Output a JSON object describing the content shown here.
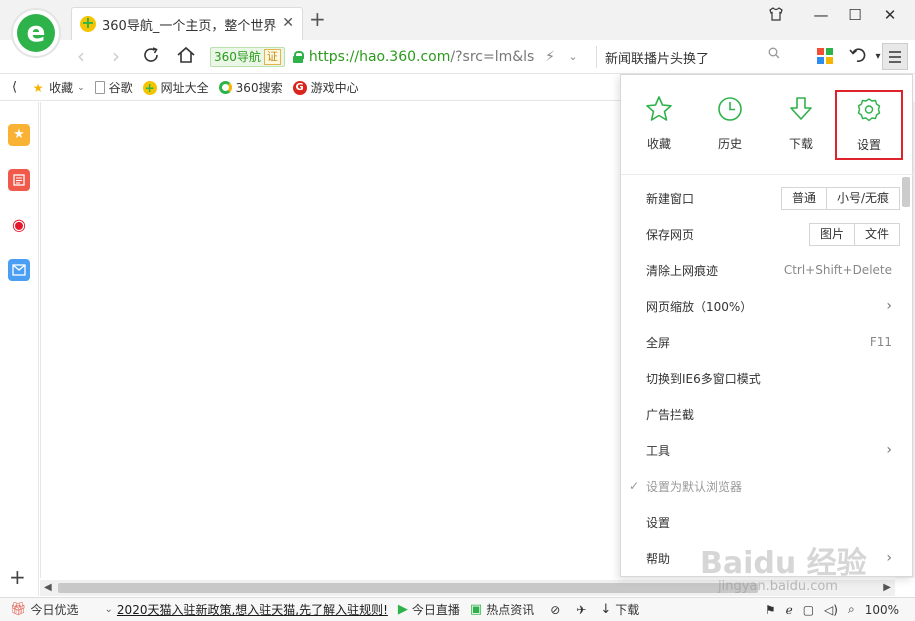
{
  "tab": {
    "title": "360导航_一个主页，整个世界",
    "close": "✕"
  },
  "newtab": "+",
  "window_controls": {
    "skin": "skin-icon",
    "minimize": "—",
    "maximize": "☐",
    "close": "✕"
  },
  "address": {
    "cert_label": "360导航",
    "cert_badge": "证",
    "url_main": "https://hao.360.com",
    "url_rest": "/?src=lm&ls"
  },
  "search": {
    "value": "新闻联播片头换了"
  },
  "bookmarks": {
    "toggle": "⟨",
    "items": [
      {
        "label": "收藏",
        "icon": "star-icon"
      },
      {
        "label": "谷歌",
        "icon": "page-icon"
      },
      {
        "label": "网址大全",
        "icon": "360-nav-icon"
      },
      {
        "label": "360搜索",
        "icon": "360-search-icon"
      },
      {
        "label": "游戏中心",
        "icon": "game-icon"
      }
    ]
  },
  "side_panel": {
    "add": "+"
  },
  "menu": {
    "quick_actions": [
      {
        "label": "收藏",
        "icon": "star-icon"
      },
      {
        "label": "历史",
        "icon": "clock-icon"
      },
      {
        "label": "下载",
        "icon": "download-icon"
      },
      {
        "label": "设置",
        "icon": "gear-icon",
        "selected": true
      }
    ],
    "new_window": {
      "label": "新建窗口",
      "options": [
        "普通",
        "小号/无痕"
      ]
    },
    "save_page": {
      "label": "保存网页",
      "options": [
        "图片",
        "文件"
      ]
    },
    "clear_history": {
      "label": "清除上网痕迹",
      "shortcut": "Ctrl+Shift+Delete"
    },
    "zoom": {
      "label": "网页缩放（100%）"
    },
    "fullscreen": {
      "label": "全屏",
      "shortcut": "F11"
    },
    "ie6_mode": {
      "label": "切换到IE6多窗口模式"
    },
    "adblock": {
      "label": "广告拦截"
    },
    "tools": {
      "label": "工具"
    },
    "set_default": {
      "label": "设置为默认浏览器"
    },
    "settings": {
      "label": "设置"
    },
    "help": {
      "label": "帮助"
    }
  },
  "statusbar": {
    "daily": "今日优选",
    "news_link": "2020天猫入驻新政策,想入驻天猫,先了解入驻规则!",
    "live": "今日直播",
    "hot": "热点资讯",
    "download": "下载",
    "zoom": "100%"
  },
  "watermark": {
    "main": "Baidu 经验",
    "sub": "jingyan.baidu.com"
  },
  "colors": {
    "accent_green": "#2eb24a",
    "highlight_red": "#e0232b"
  }
}
